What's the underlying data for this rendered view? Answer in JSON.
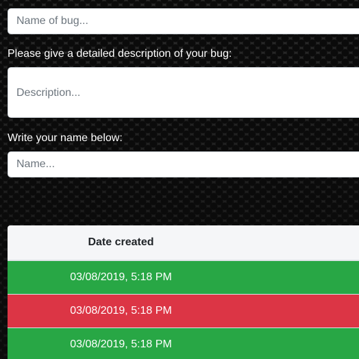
{
  "form": {
    "bug_name_placeholder": "Name of bug...",
    "description_label": "Please give a detailed description of your bug:",
    "description_placeholder": "Description...",
    "name_label": "Write your name below:",
    "name_placeholder": "Name..."
  },
  "table": {
    "header": "Date created",
    "rows": [
      {
        "date": "03/08/2019, 5:18 PM",
        "status": "success",
        "color": "#28a745"
      },
      {
        "date": "03/08/2019, 5:18 PM",
        "status": "danger",
        "color": "#dc3545"
      },
      {
        "date": "03/08/2019, 5:18 PM",
        "status": "success",
        "color": "#28a745"
      }
    ]
  }
}
